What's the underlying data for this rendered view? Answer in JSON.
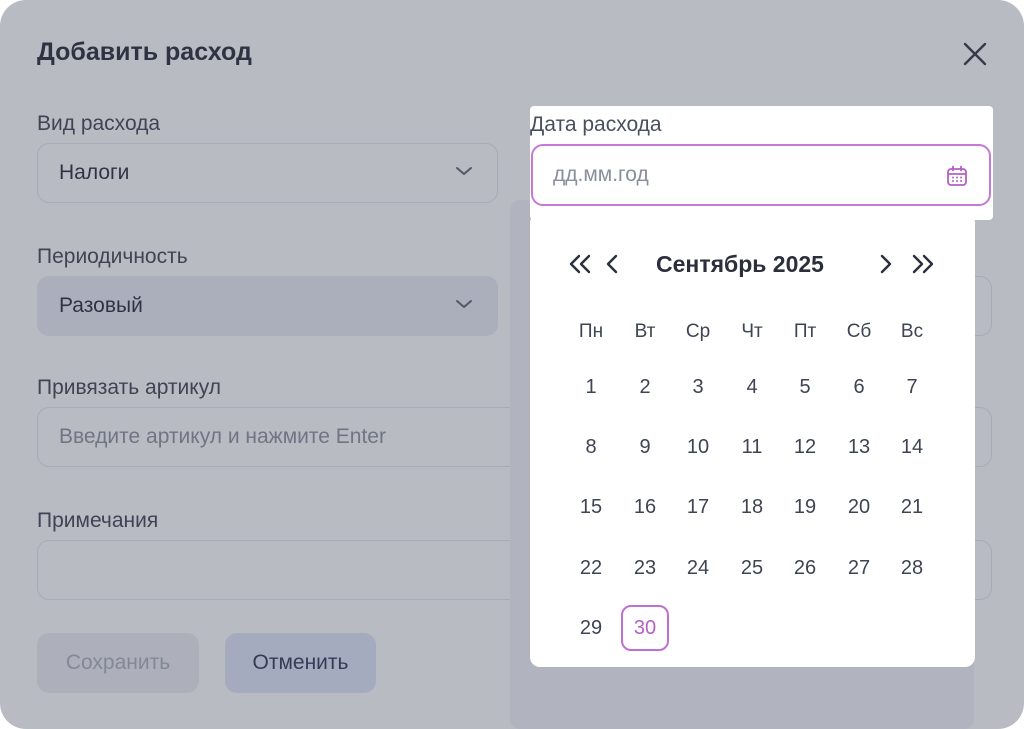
{
  "modal": {
    "title": "Добавить расход"
  },
  "fields": {
    "expense_type": {
      "label": "Вид расхода",
      "value": "Налоги"
    },
    "periodicity": {
      "label": "Периодичность",
      "value": "Разовый"
    },
    "article": {
      "label": "Привязать артикул",
      "placeholder": "Введите артикул и нажмите Enter"
    },
    "notes": {
      "label": "Примечания",
      "value": ""
    },
    "date": {
      "label": "Дата расхода",
      "placeholder": "дд.мм.год"
    }
  },
  "buttons": {
    "save": "Сохранить",
    "cancel": "Отменить"
  },
  "calendar": {
    "month_label": "Сентябрь 2025",
    "weekdays": [
      "Пн",
      "Вт",
      "Ср",
      "Чт",
      "Пт",
      "Сб",
      "Вс"
    ],
    "days": [
      "1",
      "2",
      "3",
      "4",
      "5",
      "6",
      "7",
      "8",
      "9",
      "10",
      "11",
      "12",
      "13",
      "14",
      "15",
      "16",
      "17",
      "18",
      "19",
      "20",
      "21",
      "22",
      "23",
      "24",
      "25",
      "26",
      "27",
      "28",
      "29",
      "30"
    ],
    "today": "30"
  },
  "icons": {
    "close": "close-icon",
    "chevron": "chevron-down-icon",
    "calendar": "calendar-icon"
  },
  "colors": {
    "accent": "#c678d6",
    "overlay": "#464c62"
  }
}
